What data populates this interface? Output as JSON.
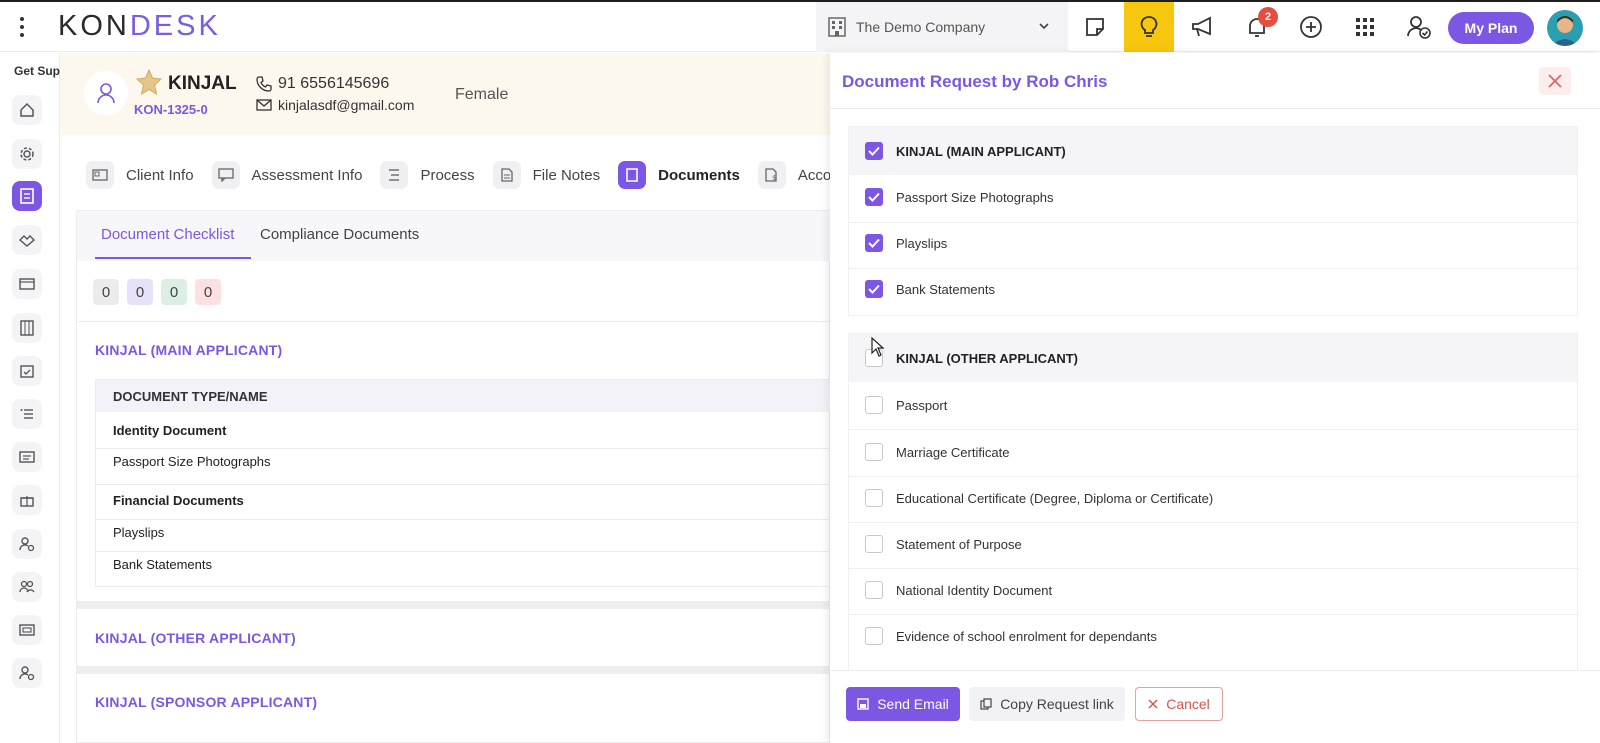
{
  "app": {
    "logo_left": "KON",
    "logo_right": "DESK",
    "company": "The Demo Company",
    "notification_count": "2",
    "my_plan_label": "My Plan",
    "accent": "#7b57e4"
  },
  "sidebar": {
    "get_support": "Get Sup",
    "items": [
      "home-icon",
      "gear-icon",
      "documents-icon",
      "handshake-icon",
      "ticket-icon",
      "building-icon",
      "calendar-check-icon",
      "list-icon",
      "id-card-icon",
      "gift-icon",
      "user-search-icon",
      "users-icon",
      "card-icon",
      "user-gear-icon"
    ]
  },
  "client": {
    "name": "KINJAL",
    "id": "KON-1325-0",
    "phone": "91 6556145696",
    "email": "kinjalasdf@gmail.com",
    "gender": "Female"
  },
  "tabs": [
    "Client Info",
    "Assessment Info",
    "Process",
    "File Notes",
    "Documents",
    "Acco"
  ],
  "main": {
    "subtabs": [
      "Document Checklist",
      "Compliance Documents"
    ],
    "counts": [
      "0",
      "0",
      "0",
      "0"
    ],
    "sections": [
      "KINJAL  (MAIN APPLICANT)",
      "KINJAL  (OTHER APPLICANT)",
      "KINJAL  (SPONSOR APPLICANT)"
    ],
    "table_header": "DOCUMENT TYPE/NAME",
    "rows": [
      "Identity Document",
      "Passport Size Photographs",
      "Financial Documents",
      "Playslips",
      "Bank Statements"
    ]
  },
  "drawer": {
    "title": "Document Request by Rob Chris",
    "group1": {
      "title": "KINJAL (MAIN APPLICANT)",
      "checked": true,
      "items": [
        "Passport Size Photographs",
        "Playslips",
        "Bank Statements"
      ]
    },
    "group2": {
      "title": "KINJAL (OTHER APPLICANT)",
      "checked": false,
      "items": [
        "Passport",
        "Marriage Certificate",
        "Educational Certificate (Degree, Diploma or Certificate)",
        "Statement of Purpose",
        "National Identity Document",
        "Evidence of school enrolment for dependants"
      ]
    },
    "buttons": {
      "send": "Send Email",
      "copy": "Copy Request link",
      "cancel": "Cancel"
    }
  }
}
